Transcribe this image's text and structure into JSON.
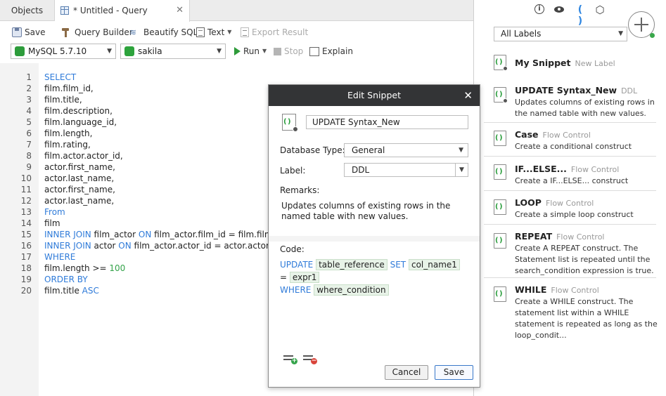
{
  "tabs": {
    "objects": "Objects",
    "query": "* Untitled - Query",
    "close": "✕"
  },
  "toolbar": {
    "save": "Save",
    "query_builder": "Query Builder",
    "beautify": "Beautify SQL",
    "text": "Text",
    "export": "Export Result"
  },
  "connection": {
    "server": "MySQL 5.7.10",
    "database": "sakila",
    "run": "Run",
    "stop": "Stop",
    "explain": "Explain"
  },
  "editor": {
    "lines": [
      {
        "n": "1",
        "parts": [
          {
            "t": "SELECT",
            "c": "kw"
          }
        ]
      },
      {
        "n": "2",
        "parts": [
          {
            "t": "film.film_id,",
            "c": ""
          }
        ]
      },
      {
        "n": "3",
        "parts": [
          {
            "t": "film.title,",
            "c": ""
          }
        ]
      },
      {
        "n": "4",
        "parts": [
          {
            "t": "film.description,",
            "c": ""
          }
        ]
      },
      {
        "n": "5",
        "parts": [
          {
            "t": "film.language_id,",
            "c": ""
          }
        ]
      },
      {
        "n": "6",
        "parts": [
          {
            "t": "film.length,",
            "c": ""
          }
        ]
      },
      {
        "n": "7",
        "parts": [
          {
            "t": "film.rating,",
            "c": ""
          }
        ]
      },
      {
        "n": "8",
        "parts": [
          {
            "t": "film.actor.actor_id,",
            "c": ""
          }
        ]
      },
      {
        "n": "9",
        "parts": [
          {
            "t": "actor.first_name,",
            "c": ""
          }
        ]
      },
      {
        "n": "10",
        "parts": [
          {
            "t": "actor.last_name,",
            "c": ""
          }
        ]
      },
      {
        "n": "11",
        "parts": [
          {
            "t": "actor.first_name,",
            "c": ""
          }
        ]
      },
      {
        "n": "12",
        "parts": [
          {
            "t": "actor.last_name,",
            "c": ""
          }
        ]
      },
      {
        "n": "13",
        "parts": [
          {
            "t": "From",
            "c": "kw"
          }
        ]
      },
      {
        "n": "14",
        "parts": [
          {
            "t": "film",
            "c": ""
          }
        ]
      },
      {
        "n": "15",
        "parts": [
          {
            "t": "INNER JOIN",
            "c": "kw"
          },
          {
            "t": " film_actor ",
            "c": ""
          },
          {
            "t": "ON",
            "c": "kw"
          },
          {
            "t": " film_actor.film_id = film.film._id",
            "c": ""
          }
        ]
      },
      {
        "n": "16",
        "parts": [
          {
            "t": "INNER JOIN",
            "c": "kw"
          },
          {
            "t": " actor ",
            "c": ""
          },
          {
            "t": "ON",
            "c": "kw"
          },
          {
            "t": " film_actor.actor_id = actor.actor_id",
            "c": ""
          }
        ]
      },
      {
        "n": "17",
        "parts": [
          {
            "t": "WHERE",
            "c": "kw"
          }
        ]
      },
      {
        "n": "18",
        "parts": [
          {
            "t": "film.length >= ",
            "c": ""
          },
          {
            "t": "100",
            "c": "num"
          }
        ]
      },
      {
        "n": "19",
        "parts": [
          {
            "t": "ORDER BY",
            "c": "kw"
          }
        ]
      },
      {
        "n": "20",
        "parts": [
          {
            "t": "film.title ",
            "c": ""
          },
          {
            "t": "ASC",
            "c": "kw"
          }
        ]
      }
    ]
  },
  "panel": {
    "labels_filter": "All Labels",
    "snippets": [
      {
        "title": "My Snippet",
        "label": "New Label",
        "desc": "",
        "user": true
      },
      {
        "title": "UPDATE Syntax_New",
        "label": "DDL",
        "desc": "Updates columns of existing rows in the named table with new values.",
        "user": true
      },
      {
        "title": "Case",
        "label": "Flow Control",
        "desc": "Create a conditional construct",
        "user": false
      },
      {
        "title": "IF...ELSE...",
        "label": "Flow Control",
        "desc": "Create a IF...ELSE... construct",
        "user": false
      },
      {
        "title": "LOOP",
        "label": "Flow Control",
        "desc": "Create a simple loop construct",
        "user": false
      },
      {
        "title": "REPEAT",
        "label": "Flow Control",
        "desc": "Create A REPEAT construct. The Statement list is repeated until the search_condition expression is true.",
        "user": false
      },
      {
        "title": "WHILE",
        "label": "Flow Control",
        "desc": "Create a WHILE construct. The statement list within a WHILE statement is repeated as long as the loop_condit...",
        "user": false
      }
    ]
  },
  "dialog": {
    "title": "Edit Snippet",
    "name": "UPDATE Syntax_New",
    "db_type_label": "Database Type:",
    "db_type": "General",
    "label_label": "Label:",
    "label_value": "DDL",
    "remarks_label": "Remarks:",
    "remarks": "Updates columns of existing rows in the named table with new values.",
    "code_label": "Code:",
    "code": {
      "kw_update": "UPDATE",
      "ph_table": "table_reference",
      "kw_set": "SET",
      "ph_col": "col_name1",
      "eq": "=",
      "ph_expr": "expr1",
      "kw_where": "WHERE",
      "ph_where": "where_condition"
    },
    "cancel": "Cancel",
    "save": "Save"
  }
}
